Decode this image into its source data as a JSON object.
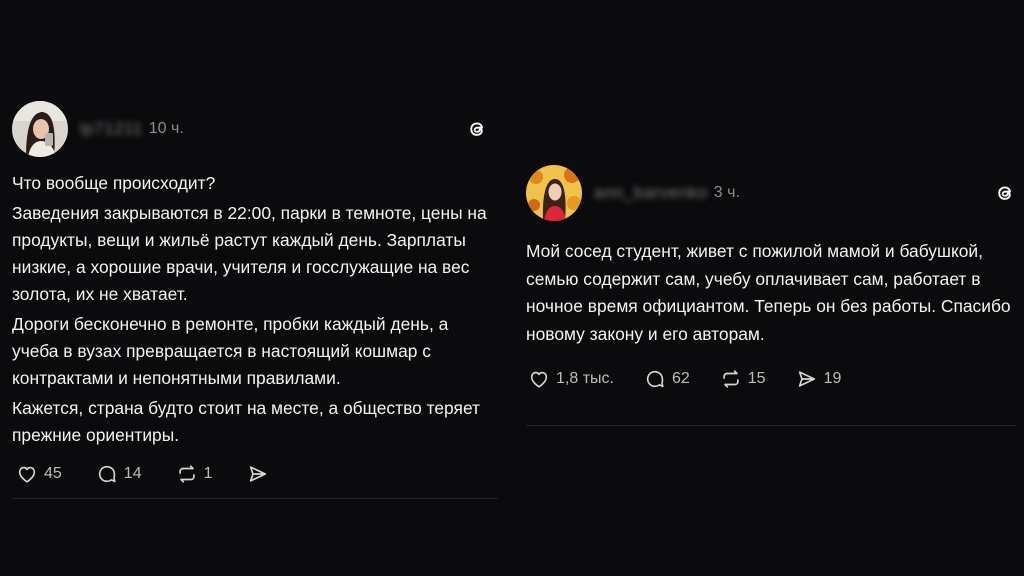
{
  "posts": [
    {
      "username": "lp71211",
      "time": "10 ч.",
      "paragraphs": [
        "Что вообще происходит?",
        "Заведения закрываются в 22:00, парки  в темноте, цены на продукты, вещи и жильё растут каждый день. Зарплаты низкие, а хорошие врачи, учителя и госслужащие на вес золота, их не хватает.",
        "Дороги бесконечно в ремонте, пробки каждый день, а учеба в вузах превращается в настоящий кошмар с контрактами и непонятными правилами.",
        "Кажется, страна будто стоит на месте, а общество теряет прежние ориентиры."
      ],
      "likes": "45",
      "comments": "14",
      "reposts": "1",
      "shares": ""
    },
    {
      "username": "ann_barvenko",
      "time": "3 ч.",
      "paragraphs": [
        "Мой сосед студент, живет с пожилой мамой и бабушкой, семью содержит сам, учебу оплачивает сам, работает в ночное время официантом. Теперь он без работы. Спасибо новому закону и его авторам."
      ],
      "likes": "1,8 тыс.",
      "comments": "62",
      "reposts": "15",
      "shares": "19"
    }
  ],
  "icons": {
    "like": "heart-icon",
    "comment": "comment-icon",
    "repost": "repost-icon",
    "share": "send-icon",
    "app": "threads-logo-icon"
  },
  "colors": {
    "background": "#0b0b0d",
    "text": "#f3f3f3",
    "muted": "#8c8c8c",
    "divider": "#232326"
  }
}
